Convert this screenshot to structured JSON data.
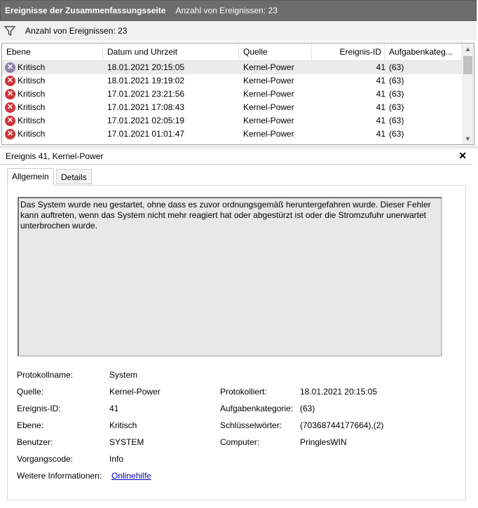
{
  "summary": {
    "title": "Ereignisse der Zusammenfassungsseite",
    "count_label": "Anzahl von Ereignissen: 23"
  },
  "filter": {
    "icon": "filter-icon",
    "text": "Anzahl von Ereignissen: 23"
  },
  "table": {
    "columns": [
      "Ebene",
      "Datum und Uhrzeit",
      "Quelle",
      "Ereignis-ID",
      "Aufgabenkateg..."
    ],
    "rows": [
      {
        "level": "Kritisch",
        "datetime": "18.01.2021 20:15:05",
        "source": "Kernel-Power",
        "id": "41",
        "category": "(63)"
      },
      {
        "level": "Kritisch",
        "datetime": "18.01.2021 19:19:02",
        "source": "Kernel-Power",
        "id": "41",
        "category": "(63)"
      },
      {
        "level": "Kritisch",
        "datetime": "17.01.2021 23:21:56",
        "source": "Kernel-Power",
        "id": "41",
        "category": "(63)"
      },
      {
        "level": "Kritisch",
        "datetime": "17.01.2021 17:08:43",
        "source": "Kernel-Power",
        "id": "41",
        "category": "(63)"
      },
      {
        "level": "Kritisch",
        "datetime": "17.01.2021 02:05:19",
        "source": "Kernel-Power",
        "id": "41",
        "category": "(63)"
      },
      {
        "level": "Kritisch",
        "datetime": "17.01.2021 01:01:47",
        "source": "Kernel-Power",
        "id": "41",
        "category": "(63)"
      }
    ]
  },
  "event": {
    "title": "Ereignis 41, Kernel-Power",
    "tabs": [
      "Allgemein",
      "Details"
    ],
    "description": "Das System wurde neu gestartet, ohne dass es zuvor ordnungsgemäß heruntergefahren wurde. Dieser Fehler kann auftreten, wenn das System nicht mehr reagiert hat oder abgestürzt ist oder die Stromzufuhr unerwartet unterbrochen wurde.",
    "fields": {
      "protokollname_label": "Protokollname:",
      "protokollname": "System",
      "quelle_label": "Quelle:",
      "quelle": "Kernel-Power",
      "protokolliert_label": "Protokolliert:",
      "protokolliert": "18.01.2021 20:15:05",
      "ereignis_id_label": "Ereignis-ID:",
      "ereignis_id": "41",
      "aufgabenkategorie_label": "Aufgabenkategorie:",
      "aufgabenkategorie": "(63)",
      "ebene_label": "Ebene:",
      "ebene": "Kritisch",
      "schluesselwoerter_label": "Schlüsselwörter:",
      "schluesselwoerter": "(70368744177664),(2)",
      "benutzer_label": "Benutzer:",
      "benutzer": "SYSTEM",
      "computer_label": "Computer:",
      "computer": "PringlesWIN",
      "vorgangscode_label": "Vorgangscode:",
      "vorgangscode": "Info",
      "weitere_label": "Weitere Informationen:",
      "weitere_link": "Onlinehilfe"
    }
  },
  "colors": {
    "header_bg": "#6d6d6d",
    "error_red": "#d13438",
    "link_blue": "#0000cc",
    "selected_row": "#ebebeb"
  }
}
